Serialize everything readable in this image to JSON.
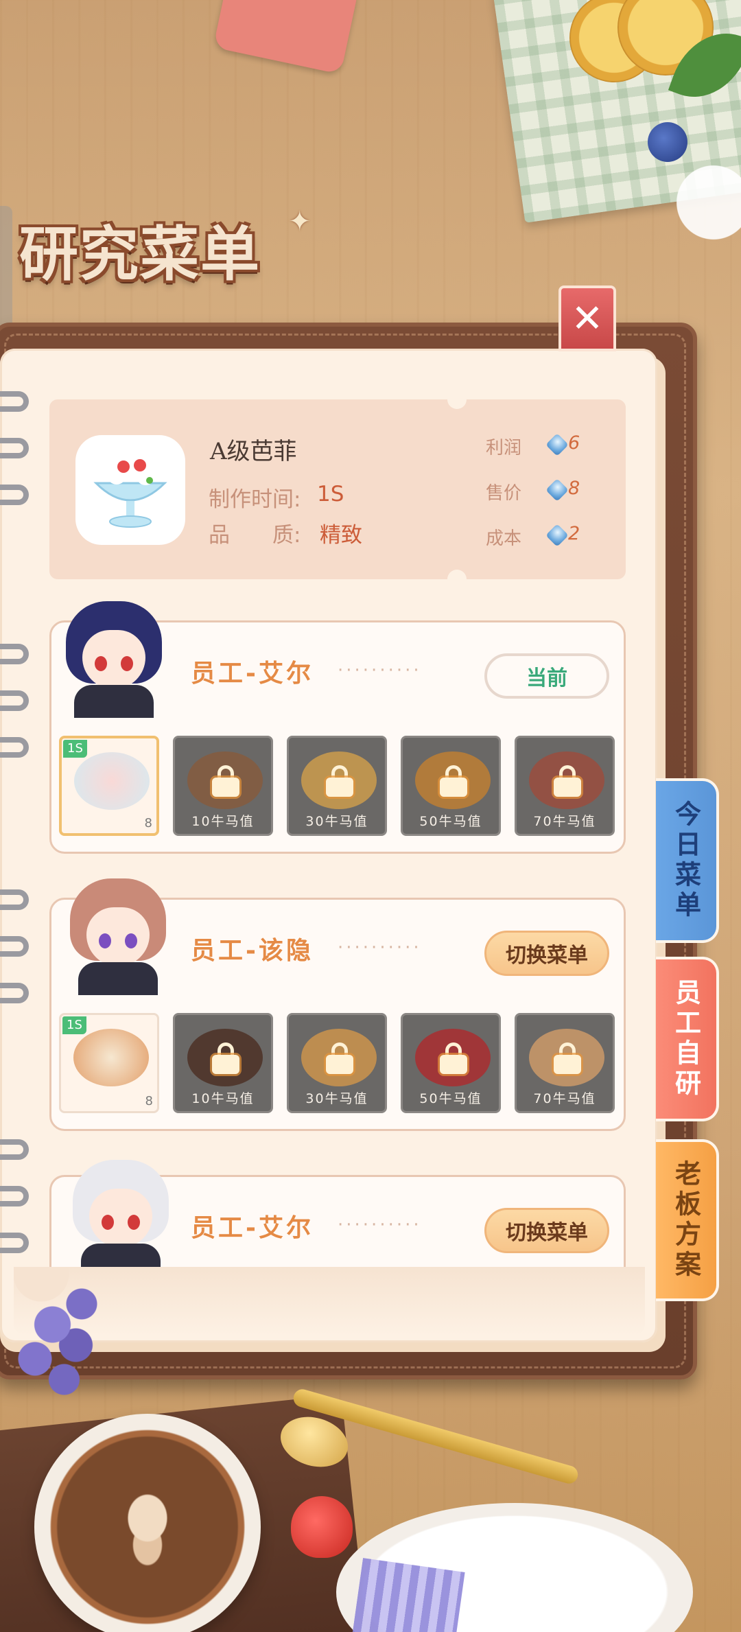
{
  "title": {
    "text": "研究菜单"
  },
  "close_label": "✕",
  "recipe": {
    "name": "A级芭菲",
    "time_label": "制作时间:",
    "time_value": "1S",
    "quality_label": "品　　质:",
    "quality_value": "精致",
    "stats": [
      {
        "label": "利润",
        "value": "6"
      },
      {
        "label": "售价",
        "value": "8"
      },
      {
        "label": "成本",
        "value": "2"
      }
    ]
  },
  "dots": "··········",
  "employees": [
    {
      "name": "员工-艾尔",
      "button": "当前",
      "button_state": "current",
      "dishes": [
        {
          "state": "unlocked",
          "badge": "1S",
          "price": "8",
          "color": "#f4c9c9"
        },
        {
          "state": "locked",
          "label": "10牛马值",
          "color": "#8a5a3a"
        },
        {
          "state": "locked",
          "label": "30牛马值",
          "color": "#d9a34a"
        },
        {
          "state": "locked",
          "label": "50牛马值",
          "color": "#c9822e"
        },
        {
          "state": "locked",
          "label": "70牛马值",
          "color": "#a24a3a"
        }
      ]
    },
    {
      "name": "员工-该隐",
      "button": "切换菜单",
      "button_state": "switch",
      "dishes": [
        {
          "state": "unlocked",
          "badge": "1S",
          "price": "8",
          "color": "#d9823f"
        },
        {
          "state": "locked",
          "label": "10牛马值",
          "color": "#4a2a1e"
        },
        {
          "state": "locked",
          "label": "30牛马值",
          "color": "#d99a4a"
        },
        {
          "state": "locked",
          "label": "50牛马值",
          "color": "#b3262a"
        },
        {
          "state": "locked",
          "label": "70牛马值",
          "color": "#d9a06a"
        }
      ]
    },
    {
      "name": "员工-艾尔",
      "button": "切换菜单",
      "button_state": "switch"
    }
  ],
  "tabs": [
    {
      "label": "今日菜单"
    },
    {
      "label": "员工自研"
    },
    {
      "label": "老板方案"
    }
  ]
}
